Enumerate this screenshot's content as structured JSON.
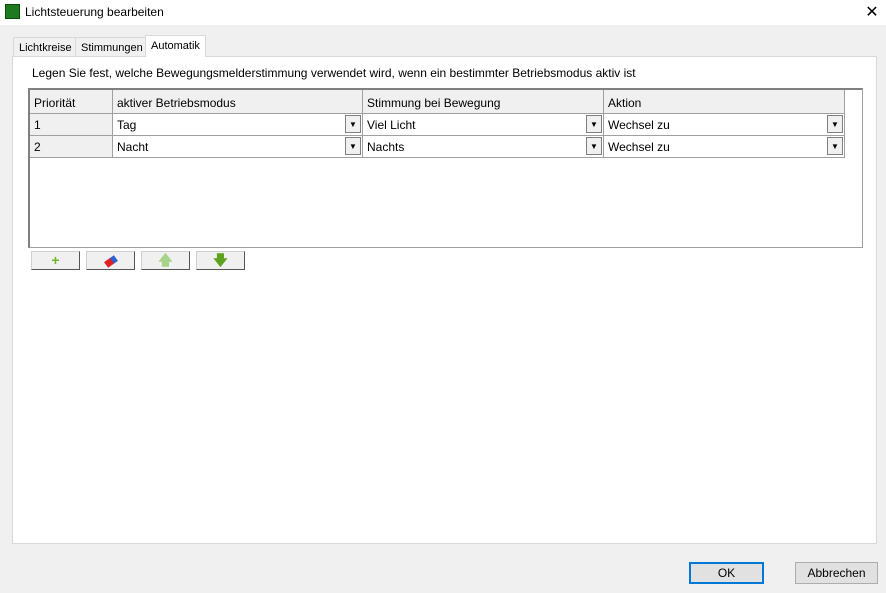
{
  "window": {
    "title": "Lichtsteuerung bearbeiten",
    "close": "✕"
  },
  "tabs": [
    {
      "label": "Lichtkreise"
    },
    {
      "label": "Stimmungen"
    },
    {
      "label": "Automatik"
    }
  ],
  "description": "Legen Sie fest, welche Bewegungsmelderstimmung verwendet wird, wenn ein bestimmter Betriebsmodus aktiv ist",
  "grid": {
    "columns": [
      "Priorität",
      "aktiver Betriebsmodus",
      "Stimmung bei Bewegung",
      "Aktion"
    ],
    "rows": [
      [
        "1",
        "Tag",
        "Viel Licht",
        "Wechsel zu"
      ],
      [
        "2",
        "Nacht",
        "Nachts",
        "Wechsel zu"
      ]
    ]
  },
  "toolbar": {
    "add": "+",
    "up": "🡅",
    "down": "🡇"
  },
  "colors": {
    "accent": "#0078d7",
    "add": "#6fb62c",
    "up": "#a6d28a",
    "down": "#5ea21f"
  },
  "buttons": {
    "ok": "OK",
    "cancel": "Abbrechen"
  }
}
